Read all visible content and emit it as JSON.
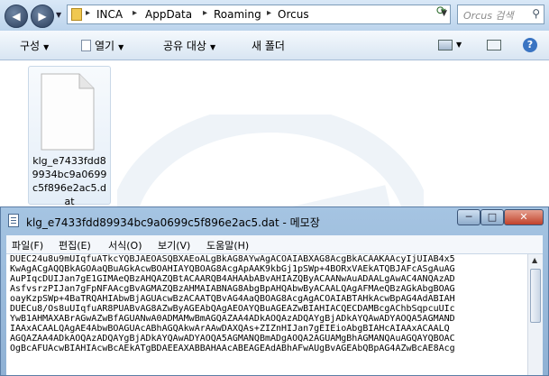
{
  "explorer": {
    "path": [
      "INCA",
      "AppData",
      "Roaming",
      "Orcus"
    ],
    "search_placeholder": "Orcus 검색",
    "toolbar": {
      "organize": "구성",
      "open": "열기",
      "share": "공유 대상",
      "new_folder": "새 폴더"
    },
    "file": {
      "name": "klg_e7433fdd89934bc9a0699c5f896e2ac5.dat"
    }
  },
  "notepad": {
    "title": "klg_e7433fdd89934bc9a0699c5f896e2ac5.dat - 메모장",
    "menu": [
      "파일(F)",
      "편집(E)",
      "서식(O)",
      "보기(V)",
      "도움말(H)"
    ],
    "lines": [
      "DUEC24u8u9mUIqfuATkcYQBJAEOASQBXAEoALgBkAG8AYwAgACOAIABXAG8AcgBkACAAKAAcyIjUIAB4x5",
      "KwAgACgAQQBkAGOAaQBuAGkAcwBOAHIAYQBOAG8AcgApAAK9kbGj1pSWp+4BORxVAEkATQBJAFcASgAuAG",
      "AuPIqcDUIJan7gE1GIMAeQBzAHQAZQBtACAARQB4AHAAbABvAHIAZQByACAANwAuADAALgAwAC4ANQAzAD",
      "AsfvsrzPIJan7gFpNFAAcgBvAGMAZQBzAHMAIABNAG8AbgBpAHQAbwByACAALQAgAFMAeQBzAGkAbgBOAG",
      "oayKzpSWp+4BaTRQAHIAbwBjAGUAcwBzACAATQBvAG4AaQBOAG8AcgAgACOAIABTAHkAcwBpAG4AdABIAH",
      "DUECu8/Os8uUIqfuAR8PUABvAG8AZwByAGEAbQAgAEOAYQBuAGEAZwBIAHIACQECDAMBcgAChbSqpcuUIc",
      "YwB1AHMAXABrAGwAZwBfAGUANwA0ADMAMwBmAGQAZAA4ADkAOQAzADQAYgBjADkAYQAwADYAOQA5AGMAND",
      "IAAxACAALQAgAE4AbwBOAGUAcABhAGQAkwArAAwDAXQAs+ZIZnHIJan7gEIEioAbgBIAHcAIAAxACAALQ",
      "AGQAZAA4ADkAOQAzADQAYgBjADkAYQAwADYAOQA5AGMANQBmADgAOQA2AGUAMgBhAGMANQAuAGQAYQBOAC",
      "OgBcAFUAcwBIAHIAcwBcAEkATgBDAEEAXABBAHAAcABEAGEAdABhAFwAUgBvAGEAbQBpAG4AZwBcAE8Acg"
    ]
  }
}
